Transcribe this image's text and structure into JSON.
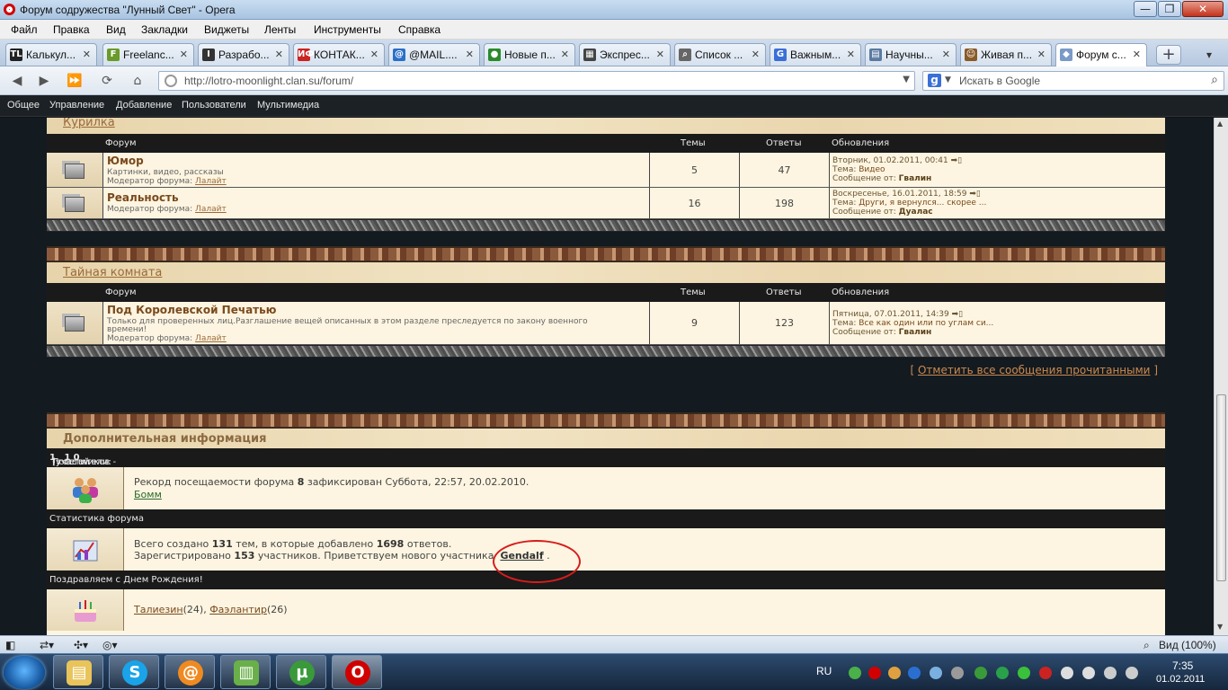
{
  "window": {
    "title": "Форум содружества \"Лунный Свет\" - Opera",
    "min": "—",
    "max": "❐",
    "close": "✕"
  },
  "menu": [
    "Файл",
    "Правка",
    "Вид",
    "Закладки",
    "Виджеты",
    "Ленты",
    "Инструменты",
    "Справка"
  ],
  "tabs": [
    {
      "label": "Калькул...",
      "fav": "TL",
      "color": "#222"
    },
    {
      "label": "Freelanc...",
      "fav": "F",
      "color": "#6a9a2a"
    },
    {
      "label": "Разрабо...",
      "fav": "I",
      "color": "#333"
    },
    {
      "label": "КОНТАК...",
      "fav": "ИФ",
      "color": "#c22"
    },
    {
      "label": "@MAIL....",
      "fav": "@",
      "color": "#2a6fc9"
    },
    {
      "label": "Новые п...",
      "fav": "●",
      "color": "#2a8a2a"
    },
    {
      "label": "Экспрес...",
      "fav": "▦",
      "color": "#444"
    },
    {
      "label": "Список ...",
      "fav": "⌕",
      "color": "#666"
    },
    {
      "label": "Важным...",
      "fav": "G",
      "color": "#3b6fd8"
    },
    {
      "label": "Научны...",
      "fav": "▤",
      "color": "#5a7aa0"
    },
    {
      "label": "Живая п...",
      "fav": "☺",
      "color": "#8a5a2a"
    },
    {
      "label": "Форум с...",
      "fav": "◆",
      "color": "#7a9ac8"
    }
  ],
  "tab_close": "✕",
  "new_tab": "+",
  "address": {
    "url": "http://lotro-moonlight.clan.su/forum/",
    "search_placeholder": "Искать в Google"
  },
  "site_nav": [
    "Общее",
    "Управление",
    "Добавление",
    "Пользователи",
    "Мультимедиа"
  ],
  "headers": {
    "forum": "Форум",
    "topics": "Темы",
    "replies": "Ответы",
    "updates": "Обновления"
  },
  "categories": [
    {
      "title": "Курилка",
      "forums": [
        {
          "name": "Юмор",
          "desc": "Картинки, видео, рассказы",
          "moderator_prefix": "Модератор форума:",
          "moderator": "Лалайт",
          "topics": "5",
          "replies": "47",
          "upd_date": "Вторник, 01.02.2011, 00:41",
          "upd_topic_prefix": "Тема:",
          "upd_topic": "Видео",
          "upd_by_prefix": "Сообщение от:",
          "upd_by": "Гвалин"
        },
        {
          "name": "Реальность",
          "desc": "",
          "moderator_prefix": "Модератор форума:",
          "moderator": "Лалайт",
          "topics": "16",
          "replies": "198",
          "upd_date": "Воскресенье, 16.01.2011, 18:59",
          "upd_topic_prefix": "Тема:",
          "upd_topic": "Други, я вернулся... скорее ...",
          "upd_by_prefix": "Сообщение от:",
          "upd_by": "Дуалас"
        }
      ]
    },
    {
      "title": "Тайная комната",
      "forums": [
        {
          "name": "Под Королевской Печатью",
          "desc": "Только для проверенных лиц.Разглашение вещей описанных в этом разделе преследуется по закону военного",
          "desc2": "времени!",
          "moderator_prefix": "Модератор форума:",
          "moderator": "Лалайт",
          "topics": "9",
          "replies": "123",
          "upd_date": "Пятница, 07.01.2011, 14:39",
          "upd_topic_prefix": "Тема:",
          "upd_topic": "Все как один или по углам си...",
          "upd_by_prefix": "Сообщение от:",
          "upd_by": "Гвалин"
        }
      ]
    }
  ],
  "mark_all": {
    "open": "[",
    "label": "Отметить все сообщения прочитанными",
    "close": "]"
  },
  "info": {
    "title": "Дополнительная информация",
    "visitors_label": "Посетители:",
    "visitors_total": "1",
    "visitors_members_label": "(участников -",
    "visitors_members": "1",
    "visitors_guests_label": ", гостей -",
    "visitors_guests": "0",
    "visitors_end": ")",
    "record_pre": "Рекорд посещаемости форума",
    "record_num": "8",
    "record_post": "зафиксирован Суббота, 22:57, 20.02.2010.",
    "record_user": "Бомм",
    "stats_label": "Статистика форума",
    "stats_pre": "Всего создано",
    "stats_topics": "131",
    "stats_mid": "тем, в которые добавлено",
    "stats_replies": "1698",
    "stats_post": "ответов.",
    "reg_pre": "Зарегистрировано",
    "reg_num": "153",
    "reg_mid": "участников. Приветствуем нового участника",
    "reg_user": "Gendalf",
    "reg_end": ".",
    "birthday_label": "Поздравляем с Днем Рождения!",
    "bday1": "Талиезин",
    "bday1_age": "(24),",
    "bday2": "Фаэлантир",
    "bday2_age": "(26)"
  },
  "status": {
    "zoom": "Вид (100%)"
  },
  "taskbar": {
    "lang": "RU",
    "time": "7:35",
    "date": "01.02.2011"
  }
}
